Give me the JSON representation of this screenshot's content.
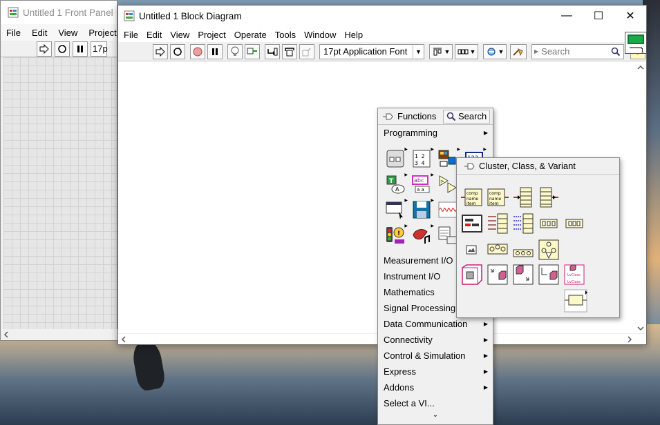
{
  "front_panel": {
    "title": "Untitled 1 Front Panel",
    "menu": [
      "File",
      "Edit",
      "View",
      "Project"
    ],
    "font_partial": "17p"
  },
  "block_diagram": {
    "title": "Untitled 1 Block Diagram",
    "controls": {
      "minimize": "—",
      "maximize": "☐",
      "close": "✕"
    },
    "menu": [
      "File",
      "Edit",
      "View",
      "Project",
      "Operate",
      "Tools",
      "Window",
      "Help"
    ],
    "toolbar": {
      "font_select": "17pt Application Font",
      "search_placeholder": "Search",
      "help": "?"
    }
  },
  "functions_palette": {
    "title": "Functions",
    "search_label": "Search",
    "first_category": "Programming",
    "categories": [
      "Measurement I/O",
      "Instrument I/O",
      "Mathematics",
      "Signal Processing",
      "Data Communication",
      "Connectivity",
      "Control & Simulation",
      "Express",
      "Addons",
      "Select a VI..."
    ],
    "more": "⌄"
  },
  "cluster_palette": {
    "title": "Cluster, Class, & Variant"
  },
  "colors": {
    "window_bg": "#f0f0f0",
    "grid_bg": "#e6e6e6",
    "cluster_fill": "#fdf8c8",
    "class_pink": "#d0187a"
  }
}
